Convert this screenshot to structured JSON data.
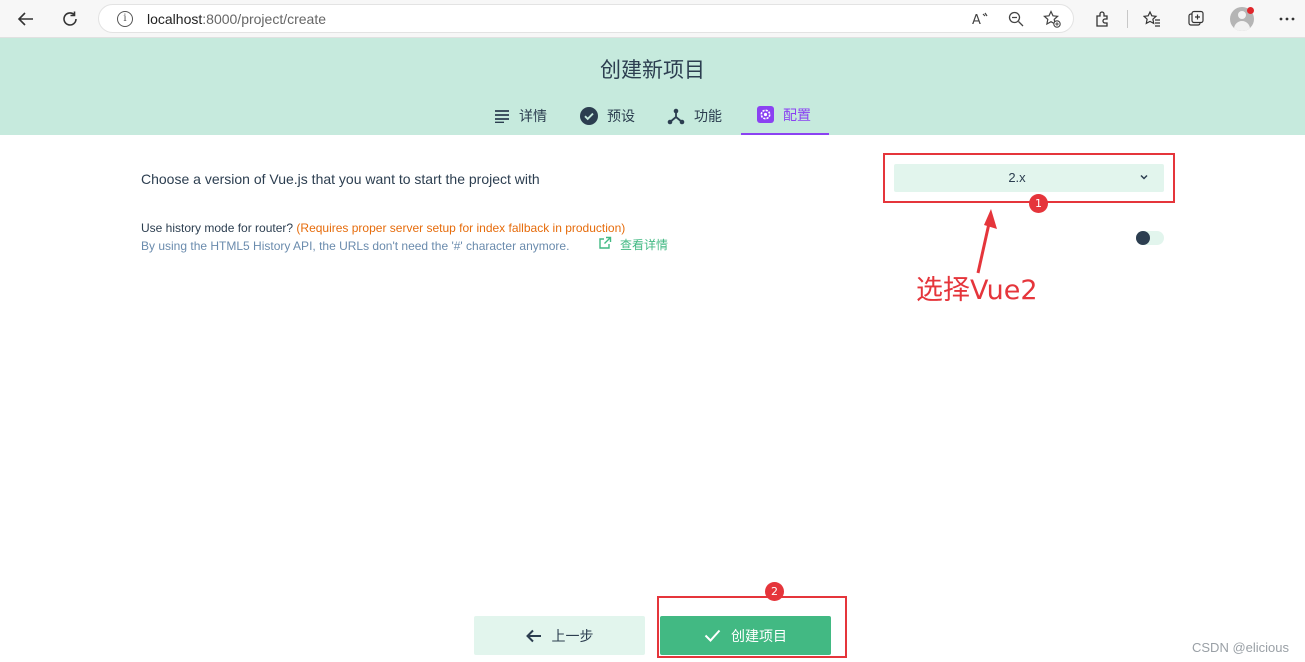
{
  "browser": {
    "url_host": "localhost",
    "url_rest": ":8000/project/create"
  },
  "header": {
    "title": "创建新项目",
    "tabs": [
      {
        "label": "详情",
        "icon": "list-icon"
      },
      {
        "label": "预设",
        "icon": "check-circle-icon"
      },
      {
        "label": "功能",
        "icon": "fork-icon"
      },
      {
        "label": "配置",
        "icon": "settings-icon",
        "active": true
      }
    ]
  },
  "config": {
    "vue_version_label": "Choose a version of Vue.js that you want to start the project with",
    "vue_version_value": "2.x",
    "history_title": "Use history mode for router?",
    "history_warning": "(Requires proper server setup for index fallback in production)",
    "history_desc": "By using the HTML5 History API, the URLs don't need the '#' character anymore.",
    "history_link": "查看详情",
    "history_enabled": false
  },
  "annotations": {
    "badge1": "1",
    "badge2": "2",
    "note": "选择Vue2"
  },
  "footer": {
    "prev_label": "上一步",
    "create_label": "创建项目"
  },
  "watermark": "CSDN @elicious",
  "colors": {
    "header_bg": "#c6eadd",
    "accent_green": "#42b983",
    "active_tab": "#8b42f2",
    "annotation_red": "#e5353b"
  }
}
